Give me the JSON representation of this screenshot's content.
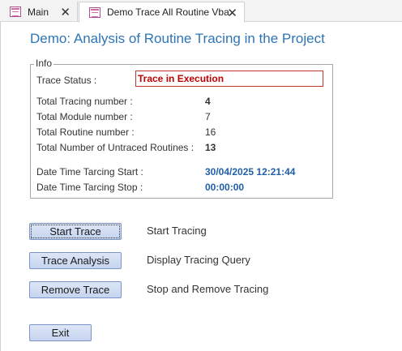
{
  "tabs": [
    {
      "label": "Main",
      "close": "✕"
    },
    {
      "label": "Demo Trace All Routine Vba",
      "close": "✕"
    }
  ],
  "form": {
    "title": "Demo: Analysis of Routine Tracing in the Project",
    "info_legend": "Info",
    "trace_status_label": "Trace Status :",
    "trace_status_value": "Trace in Execution",
    "total_tracing_label": "Total Tracing number :",
    "total_tracing_value": "4",
    "total_module_label": "Total Module number :",
    "total_module_value": "7",
    "total_routine_label": "Total Routine number :",
    "total_routine_value": "16",
    "untraced_label": "Total Number of Untraced Routines :",
    "untraced_value": "13",
    "start_label": "Date Time Tarcing Start :",
    "start_value": "30/04/2025 12:21:44",
    "stop_label": "Date Time Tarcing Stop :",
    "stop_value": "00:00:00"
  },
  "actions": {
    "start_button": "Start Trace",
    "start_desc": "Start Tracing",
    "analysis_button": "Trace Analysis",
    "analysis_desc": "Display Tracing Query",
    "remove_button": "Remove Trace",
    "remove_desc": "Stop and Remove Tracing",
    "exit_button": "Exit"
  },
  "colors": {
    "title": "#2e75b6",
    "status_text": "#c00000",
    "date_values": "#1f5fa8",
    "button_border": "#7b96c6"
  }
}
